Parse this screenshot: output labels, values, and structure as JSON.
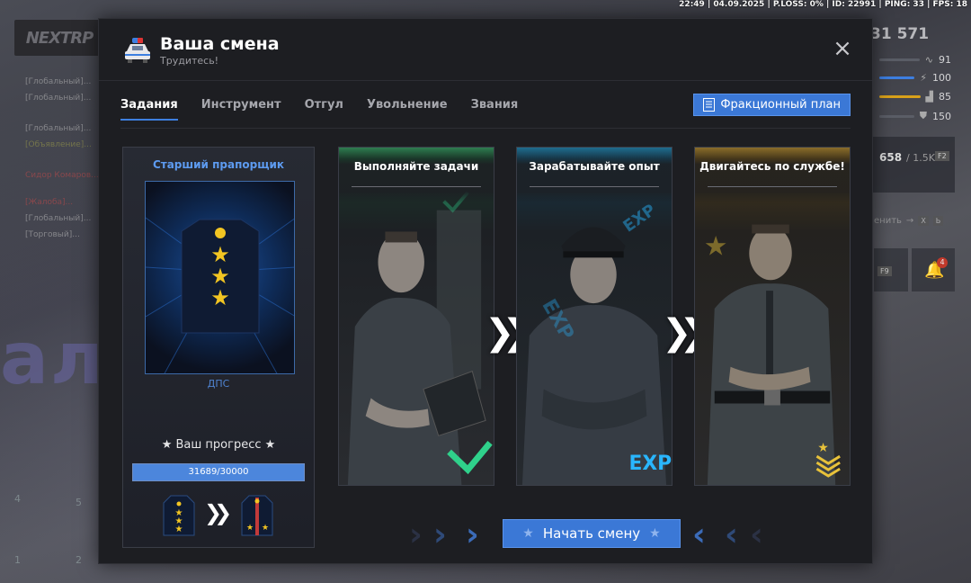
{
  "status_bar": "22:49 | 04.09.2025 | P.LOSS: 0% | ID: 22991 | PING: 33 | FPS: 18",
  "hud": {
    "logo": "NEXTRP",
    "money": "31 571",
    "stats": [
      "91",
      "100",
      "85",
      "150"
    ],
    "ammo": "658",
    "ammo_max": "/ 1.5K",
    "f2": "F2",
    "f9": "F9",
    "notif": "4",
    "bg_text": "ал",
    "side_hint": "енить",
    "key_x": "X",
    "key_b": "Ь",
    "slots": [
      "4",
      "5",
      "1",
      "2"
    ],
    "chat": [
      "[Глобальный]...",
      "[Глобальный]...",
      "[Глобальный]...",
      "[Объявление]...",
      "Сидор Комаров...",
      "[Жалоба]...",
      "[Глобальный]...",
      "[Торговый]..."
    ]
  },
  "modal": {
    "title": "Ваша смена",
    "subtitle": "Трудитесь!",
    "close_icon": "close-icon",
    "tabs": [
      {
        "label": "Задания",
        "active": true
      },
      {
        "label": "Инструмент",
        "active": false
      },
      {
        "label": "Отгул",
        "active": false
      },
      {
        "label": "Увольнение",
        "active": false
      },
      {
        "label": "Звания",
        "active": false
      }
    ],
    "faction_plan_button": "Фракционный план",
    "rank": {
      "title": "Старший прапорщик",
      "unit": "ДПС",
      "progress_label": "Ваш прогресс",
      "progress_current": 31689,
      "progress_max": 30000,
      "progress_text": "31689/30000"
    },
    "cards": [
      {
        "title": "Выполняйте задачи",
        "accent": "#2e7d4f",
        "badge": "checkmark-icon"
      },
      {
        "title": "Зарабатывайте опыт",
        "accent": "#1f6d8f",
        "badge": "EXP"
      },
      {
        "title": "Двигайтесь по службе!",
        "accent": "#8a6d2a",
        "badge": "rank-chevron-icon"
      }
    ],
    "start_button": "Начать смену",
    "colors": {
      "accent": "#3b78d6",
      "rank_title": "#5d9bf0",
      "check": "#2fd18b",
      "exp": "#29b6ff",
      "gold": "#e8c23a"
    }
  }
}
